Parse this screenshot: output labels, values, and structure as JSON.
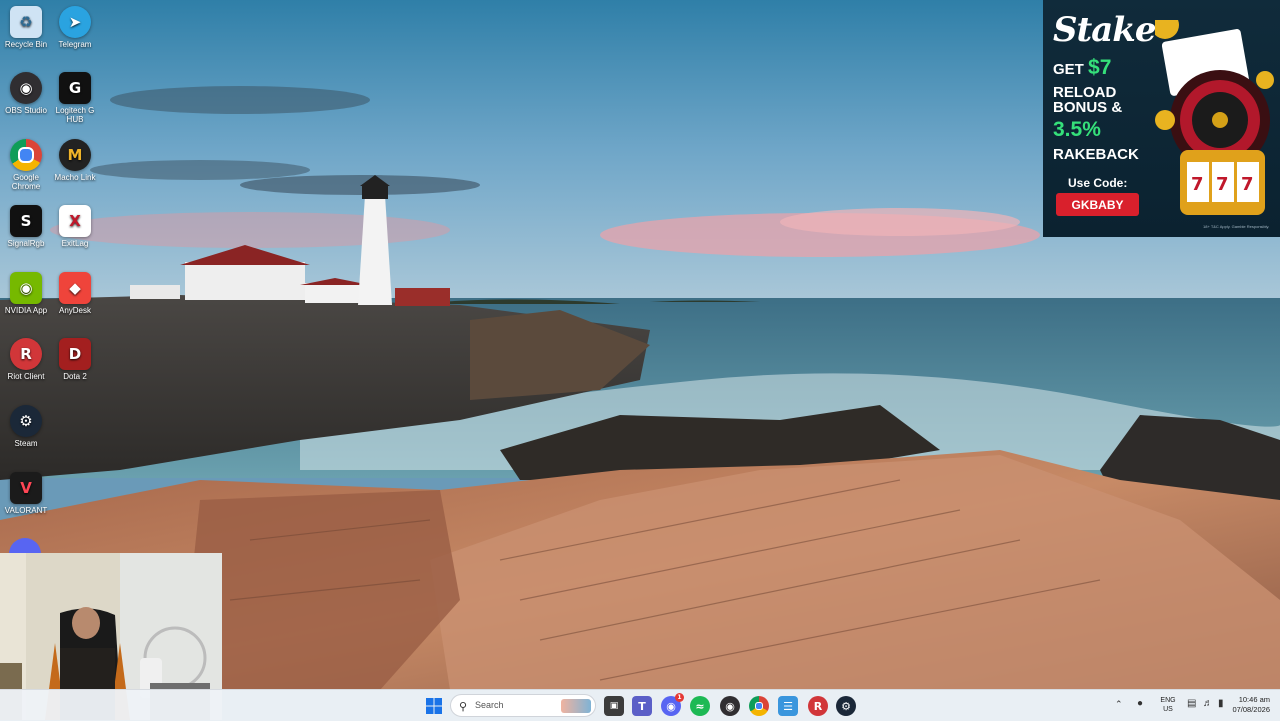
{
  "desktop_icons": [
    {
      "label": "Recycle Bin",
      "icon": "recycle-bin-icon",
      "color": "#cfe3f4"
    },
    {
      "label": "Telegram",
      "icon": "telegram-icon",
      "color": "#2aa3e0"
    },
    {
      "label": "OBS Studio",
      "icon": "obs-icon",
      "color": "#302e31"
    },
    {
      "label": "Logitech G HUB",
      "icon": "logitech-icon",
      "color": "#111111"
    },
    {
      "label": "Google Chrome",
      "icon": "chrome-icon",
      "color": "#dd4b39"
    },
    {
      "label": "Macho Link",
      "icon": "macho-link-icon",
      "color": "#222222"
    },
    {
      "label": "SignalRgb",
      "icon": "signalrgb-icon",
      "color": "#111111"
    },
    {
      "label": "ExitLag",
      "icon": "exitlag-icon",
      "color": "#c0182b"
    },
    {
      "label": "NVIDIA App",
      "icon": "nvidia-icon",
      "color": "#76b900"
    },
    {
      "label": "AnyDesk",
      "icon": "anydesk-icon",
      "color": "#ef443b"
    },
    {
      "label": "Riot Client",
      "icon": "riot-icon",
      "color": "#d13639"
    },
    {
      "label": "Dota 2",
      "icon": "dota-icon",
      "color": "#a31f1f"
    },
    {
      "label": "Steam",
      "icon": "steam-icon",
      "color": "#1b2838"
    },
    {
      "label": "VALORANT",
      "icon": "valorant-icon",
      "color": "#ff4655"
    }
  ],
  "ad": {
    "brand": "Stake",
    "line1_prefix": "GET",
    "line1_amount": "$7",
    "line2": "RELOAD",
    "line3": "BONUS &",
    "line4": "3.5%",
    "line5": "RAKEBACK",
    "code_label": "Use Code:",
    "code": "GKBABY",
    "fine_print": "18+ T&C Apply. Gamble Responsibly."
  },
  "taskbar": {
    "search_placeholder": "Search",
    "lang_top": "ENG",
    "lang_bottom": "US",
    "time": "10:46 am",
    "date": "07/08/2026",
    "discord_badge": "1"
  },
  "colors": {
    "taskbar_bg": "#eef2f7",
    "ad_accent": "#35e07a",
    "ad_button": "#d9202c"
  }
}
